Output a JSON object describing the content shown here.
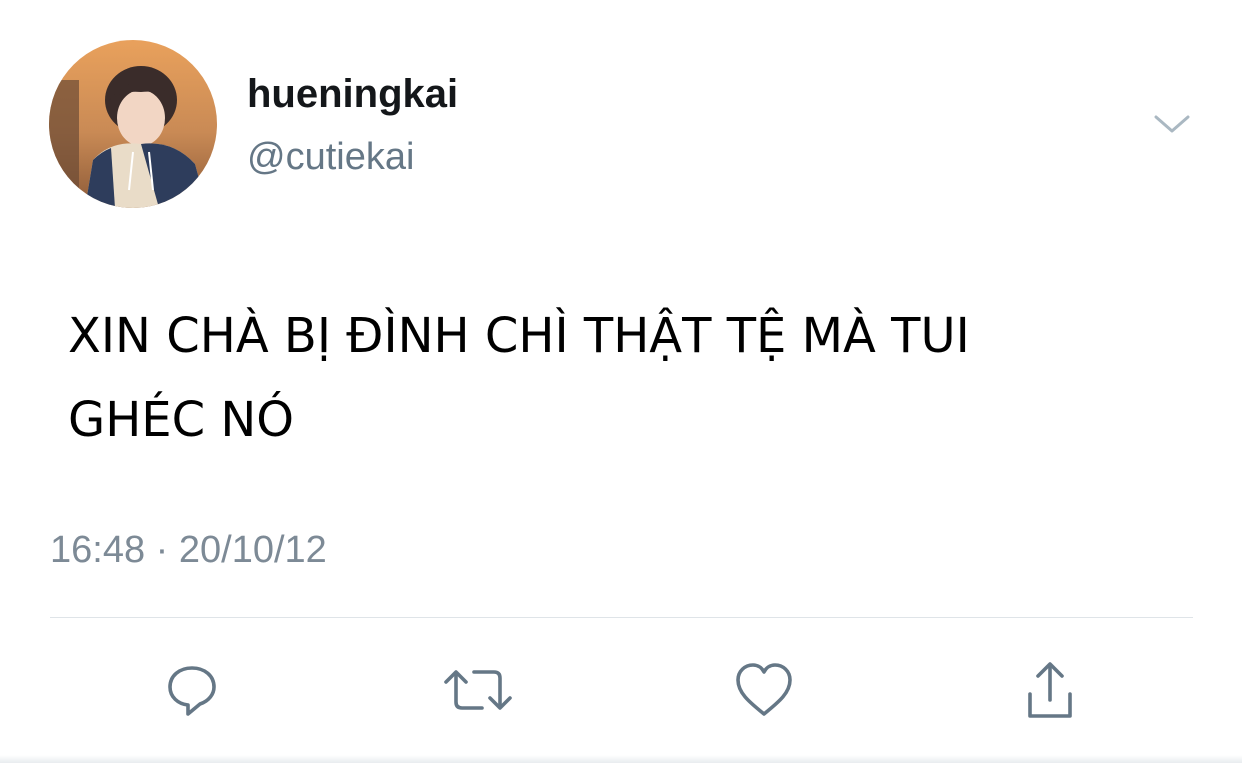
{
  "user": {
    "display_name": "hueningkai",
    "handle": "@cutiekai"
  },
  "tweet": {
    "text_lines": [
      "XIN CHÀ BỊ ĐÌNH CHÌ THẬT TỆ MÀ TUI",
      "GHÉC NÓ"
    ],
    "time": "16:48",
    "separator": "·",
    "date": "20/10/12"
  },
  "actions": [
    {
      "icon": "reply-icon"
    },
    {
      "icon": "retweet-icon"
    },
    {
      "icon": "like-icon"
    },
    {
      "icon": "share-icon"
    }
  ],
  "colors": {
    "name": "#14171a",
    "secondary": "#657786",
    "icon": "#657786",
    "divider": "#dfe4e8",
    "text": "#000000"
  }
}
